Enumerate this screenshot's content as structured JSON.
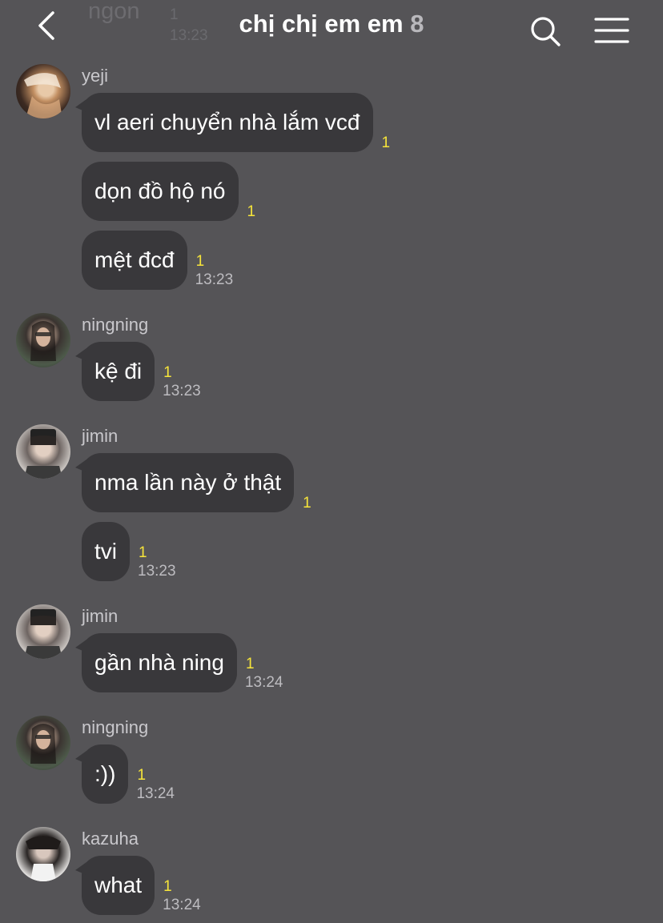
{
  "header": {
    "title": "chị chị em em",
    "member_count": "8",
    "back_icon": "chevron-left-icon",
    "search_icon": "search-icon",
    "menu_icon": "hamburger-menu-icon",
    "behind": {
      "name": "ngon",
      "unread": "1",
      "time": "13:23"
    }
  },
  "messages": [
    {
      "sender": "yeji",
      "avatar": "avatar-yeji",
      "items": [
        {
          "text": "vl aeri chuyển nhà lắm vcđ",
          "unread": "1",
          "time": ""
        },
        {
          "text": "dọn đồ hộ nó",
          "unread": "1",
          "time": ""
        },
        {
          "text": "mệt đcđ",
          "unread": "1",
          "time": "13:23"
        }
      ]
    },
    {
      "sender": "ningning",
      "avatar": "avatar-ningning",
      "items": [
        {
          "text": "kệ đi",
          "unread": "1",
          "time": "13:23"
        }
      ]
    },
    {
      "sender": "jimin",
      "avatar": "avatar-jimin",
      "items": [
        {
          "text": "nma lần này ở thật",
          "unread": "1",
          "time": ""
        },
        {
          "text": "tvi",
          "unread": "1",
          "time": "13:23"
        }
      ]
    },
    {
      "sender": "jimin",
      "avatar": "avatar-jimin",
      "items": [
        {
          "text": "gần nhà ning",
          "unread": "1",
          "time": "13:24"
        }
      ]
    },
    {
      "sender": "ningning",
      "avatar": "avatar-ningning",
      "items": [
        {
          "text": ":))",
          "unread": "1",
          "time": "13:24"
        }
      ]
    },
    {
      "sender": "kazuha",
      "avatar": "avatar-kazuha",
      "items": [
        {
          "text": "what",
          "unread": "1",
          "time": "13:24"
        }
      ]
    }
  ]
}
